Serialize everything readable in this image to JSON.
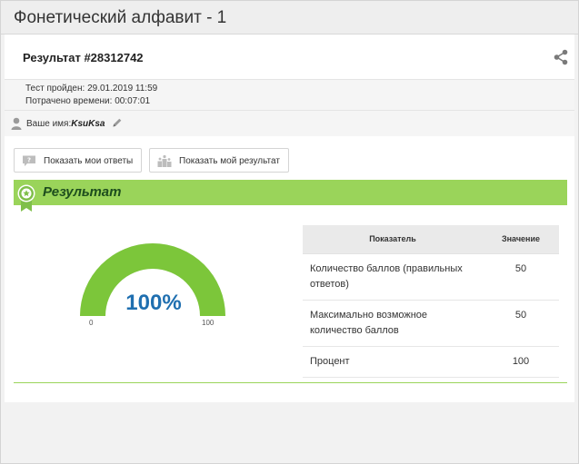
{
  "window": {
    "title": "Фонетический алфавит - 1"
  },
  "result": {
    "title": "Результат #28312742",
    "completed_label": "Тест пройден:",
    "completed_value": "29.01.2019 11:59",
    "time_label": "Потрачено времени:",
    "time_value": "00:07:01"
  },
  "user": {
    "label": "Ваше имя:",
    "name": "KsuKsa"
  },
  "buttons": {
    "show_answers": "Показать мои ответы",
    "show_result": "Показать мой результат"
  },
  "section": {
    "title": "Результат"
  },
  "gauge": {
    "value_label": "100%",
    "percent": 100,
    "min": "0",
    "max": "100"
  },
  "table": {
    "headers": [
      "Показатель",
      "Значение"
    ],
    "rows": [
      [
        "Количество баллов (правильных ответов)",
        "50"
      ],
      [
        "Максимально возможное количество баллов",
        "50"
      ],
      [
        "Процент",
        "100"
      ]
    ]
  },
  "colors": {
    "accent_green": "#9ad45a",
    "gauge_green": "#7cc63a",
    "gauge_track": "#e6e6e6",
    "value_blue": "#1f6fb0"
  },
  "icons": {
    "share": "share-icon",
    "user": "user-icon",
    "edit": "pencil-icon",
    "answers": "question-chat-icon",
    "result": "podium-icon",
    "badge": "award-ribbon-icon"
  }
}
